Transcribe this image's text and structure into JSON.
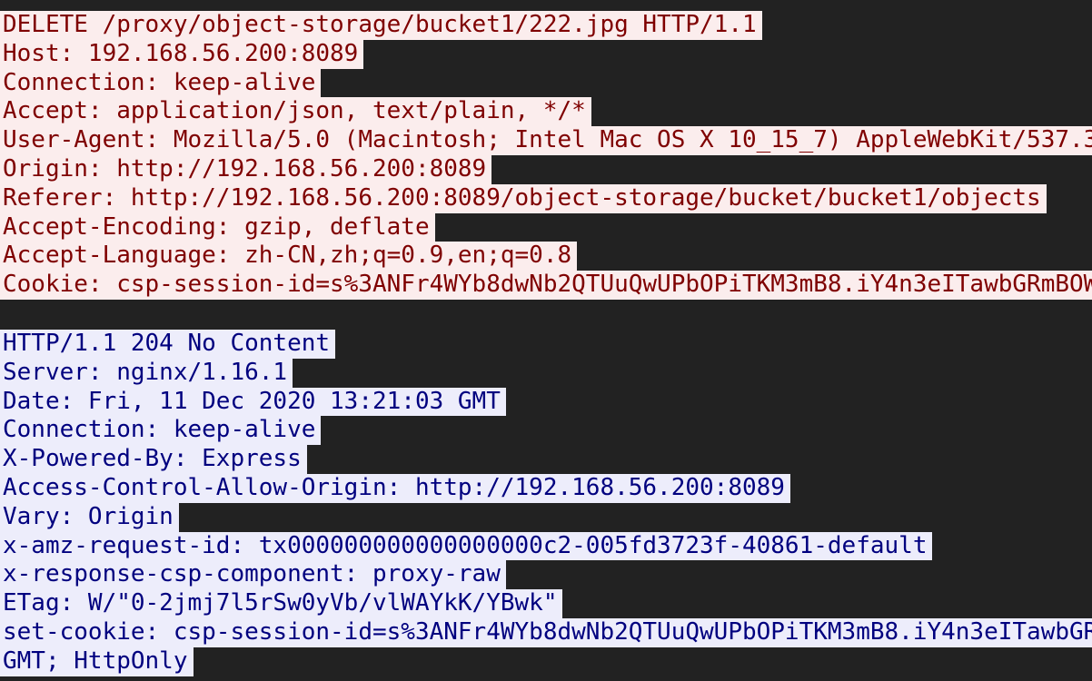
{
  "request": {
    "lines": [
      "DELETE /proxy/object-storage/bucket1/222.jpg HTTP/1.1",
      "Host: 192.168.56.200:8089",
      "Connection: keep-alive",
      "Accept: application/json, text/plain, */*",
      "User-Agent: Mozilla/5.0 (Macintosh; Intel Mac OS X 10_15_7) AppleWebKit/537.3",
      "Origin: http://192.168.56.200:8089",
      "Referer: http://192.168.56.200:8089/object-storage/bucket/bucket1/objects",
      "Accept-Encoding: gzip, deflate",
      "Accept-Language: zh-CN,zh;q=0.9,en;q=0.8",
      "Cookie: csp-session-id=s%3ANFr4WYb8dwNb2QTUuQwUPbOPiTKM3mB8.iY4n3eITawbGRmBOW"
    ]
  },
  "response": {
    "lines": [
      "HTTP/1.1 204 No Content",
      "Server: nginx/1.16.1",
      "Date: Fri, 11 Dec 2020 13:21:03 GMT",
      "Connection: keep-alive",
      "X-Powered-By: Express",
      "Access-Control-Allow-Origin: http://192.168.56.200:8089",
      "Vary: Origin",
      "x-amz-request-id: tx000000000000000000c2-005fd3723f-40861-default",
      "x-response-csp-component: proxy-raw",
      "ETag: W/\"0-2jmj7l5rSw0yVb/vlWAYkK/YBwk\"",
      "set-cookie: csp-session-id=s%3ANFr4WYb8dwNb2QTUuQwUPbOPiTKM3mB8.iY4n3eITawbGR",
      "GMT; HttpOnly"
    ]
  },
  "colors": {
    "background": "#222222",
    "request_highlight": "#fbeded",
    "request_text": "#7f0000",
    "response_highlight": "#ededfb",
    "response_text": "#00007f"
  }
}
